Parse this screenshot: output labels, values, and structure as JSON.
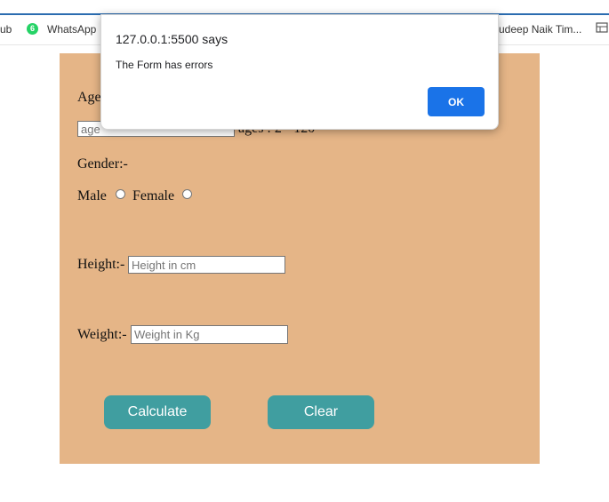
{
  "bookmarks_bar": {
    "items": [
      {
        "label": "ub"
      },
      {
        "label": "WhatsApp",
        "badge": "6"
      },
      {
        "label": "rudeep Naik Tim..."
      }
    ]
  },
  "form": {
    "background": "#e5b587",
    "age": {
      "label": "Age",
      "placeholder": "age",
      "hint": "ages : 2 - 120"
    },
    "gender": {
      "label": "Gender:-",
      "options": [
        "Male",
        "Female"
      ]
    },
    "height": {
      "label": "Height:-",
      "placeholder": "Height in cm"
    },
    "weight": {
      "label": "Weight:-",
      "placeholder": "Weight in Kg"
    },
    "buttons": {
      "calculate": "Calculate",
      "clear": "Clear",
      "color": "#409ea0"
    }
  },
  "alert_dialog": {
    "title": "127.0.0.1:5500 says",
    "message": "The Form has errors",
    "ok_label": "OK",
    "accent": "#1a73e8"
  }
}
